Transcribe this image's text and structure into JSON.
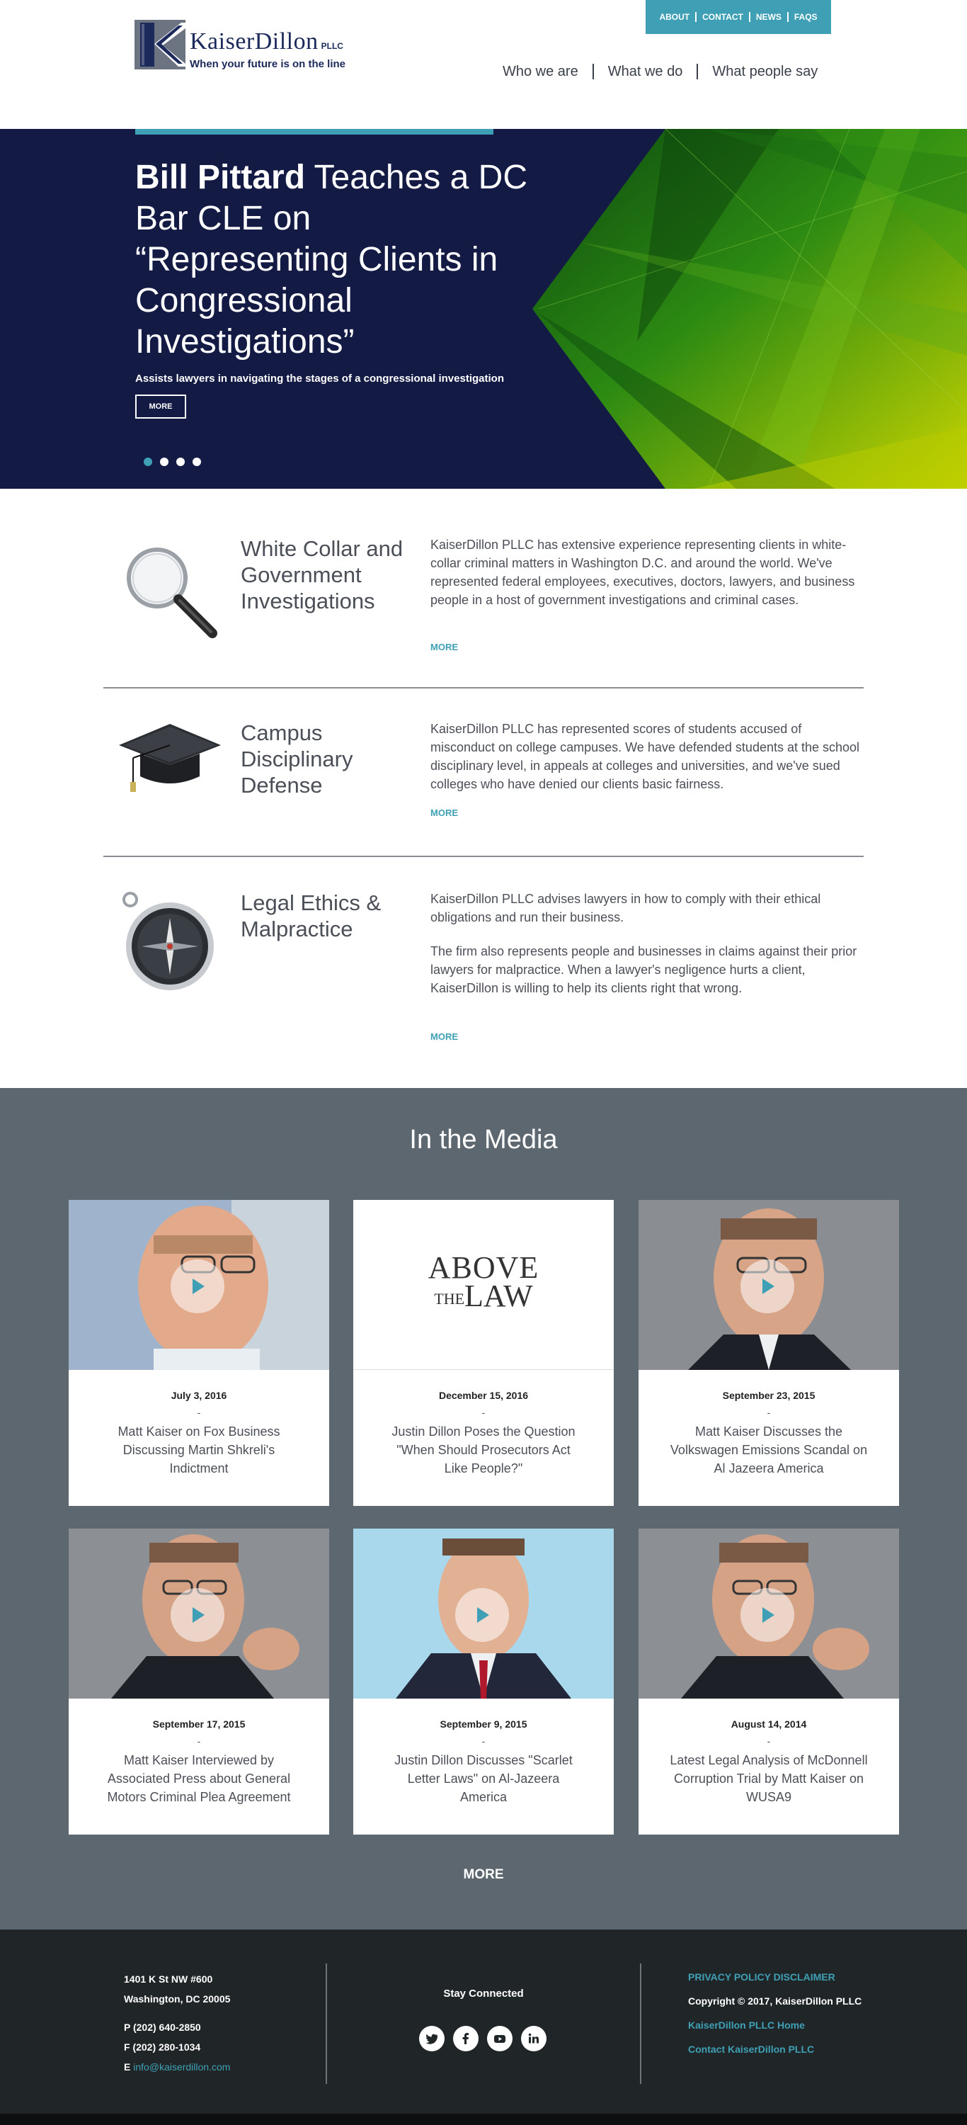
{
  "header": {
    "logo_name": "KaiserDillon",
    "logo_suffix": "PLLC",
    "logo_tagline": "When your future is on the line",
    "utility_nav": [
      "ABOUT",
      "CONTACT",
      "NEWS",
      "FAQS"
    ],
    "main_nav": [
      "Who we are",
      "What we do",
      "What people say"
    ]
  },
  "hero": {
    "title_bold": "Bill Pittard",
    "title_rest": " Teaches a DC Bar CLE on “Representing Clients in Congressional Investigations”",
    "subtitle": "Assists lawyers in navigating the stages of a congressional investigation",
    "more_label": "MORE",
    "slide_count": 4,
    "active_slide": 1
  },
  "practice_areas": [
    {
      "title": "White Collar and Government Investigations",
      "paragraphs": [
        "KaiserDillon PLLC has extensive experience representing clients in white-collar criminal matters in Washington D.C. and around the world. We've represented federal employees, executives, doctors, lawyers, and business people in a host of government investigations and criminal cases."
      ],
      "more_label": "MORE",
      "icon": "magnifying-glass-icon"
    },
    {
      "title": "Campus Disciplinary Defense",
      "paragraphs": [
        "KaiserDillon PLLC has represented scores of students accused of misconduct on college campuses. We have defended students at the school disciplinary level, in appeals at colleges and universities, and we've sued colleges who have denied our clients basic fairness."
      ],
      "more_label": "MORE",
      "icon": "graduation-cap-icon"
    },
    {
      "title": "Legal Ethics & Malpractice",
      "paragraphs": [
        "KaiserDillon PLLC advises lawyers in how to comply with their ethical obligations and run their business.",
        "The firm also represents people and businesses in claims against their prior lawyers for malpractice. When a lawyer's negligence hurts a client, KaiserDillon is willing to help its clients right that wrong."
      ],
      "more_label": "MORE",
      "icon": "compass-icon"
    }
  ],
  "media": {
    "title": "In the Media",
    "more_label": "MORE",
    "items": [
      {
        "date": "July 3, 2016",
        "title": "Matt Kaiser on Fox Business Discussing Martin Shkreli's Indictment",
        "video": true
      },
      {
        "date": "December 15, 2016",
        "title": "Justin Dillon Poses the Question \"When Should Prosecutors Act Like People?\"",
        "video": false,
        "logo_line1": "ABOVE",
        "logo_line2a": "THE",
        "logo_line2b": "LAW"
      },
      {
        "date": "September 23, 2015",
        "title": "Matt Kaiser Discusses the Volkswagen Emissions Scandal on Al Jazeera America",
        "video": true
      },
      {
        "date": "September 17, 2015",
        "title": "Matt Kaiser Interviewed by Associated Press about General Motors Criminal Plea Agreement",
        "video": true
      },
      {
        "date": "September 9, 2015",
        "title": "Justin Dillon Discusses \"Scarlet Letter Laws\" on Al-Jazeera America",
        "video": true
      },
      {
        "date": "August 14, 2014",
        "title": "Latest Legal Analysis of McDonnell Corruption Trial by Matt Kaiser on WUSA9",
        "video": true
      }
    ],
    "separator": "-"
  },
  "footer": {
    "address_line1": "1401 K St NW #600",
    "address_line2": "Washington, DC 20005",
    "phone": "P (202) 640-2850",
    "fax": "F (202) 280-1034",
    "email_prefix": "E ",
    "email": "info@kaiserdillon.com",
    "stay_connected": "Stay Connected",
    "socials": [
      "twitter-icon",
      "facebook-icon",
      "youtube-icon",
      "linkedin-icon"
    ],
    "privacy": "PRIVACY POLICY DISCLAIMER",
    "copyright": "Copyright © 2017, KaiserDillon PLLC",
    "home_link": "KaiserDillon PLLC Home",
    "contact_link": "Contact KaiserDillon PLLC"
  },
  "colors": {
    "accent": "#3fa0b5",
    "navy": "#131b45",
    "media_bg": "#5c6770",
    "footer_bg": "#202628"
  }
}
